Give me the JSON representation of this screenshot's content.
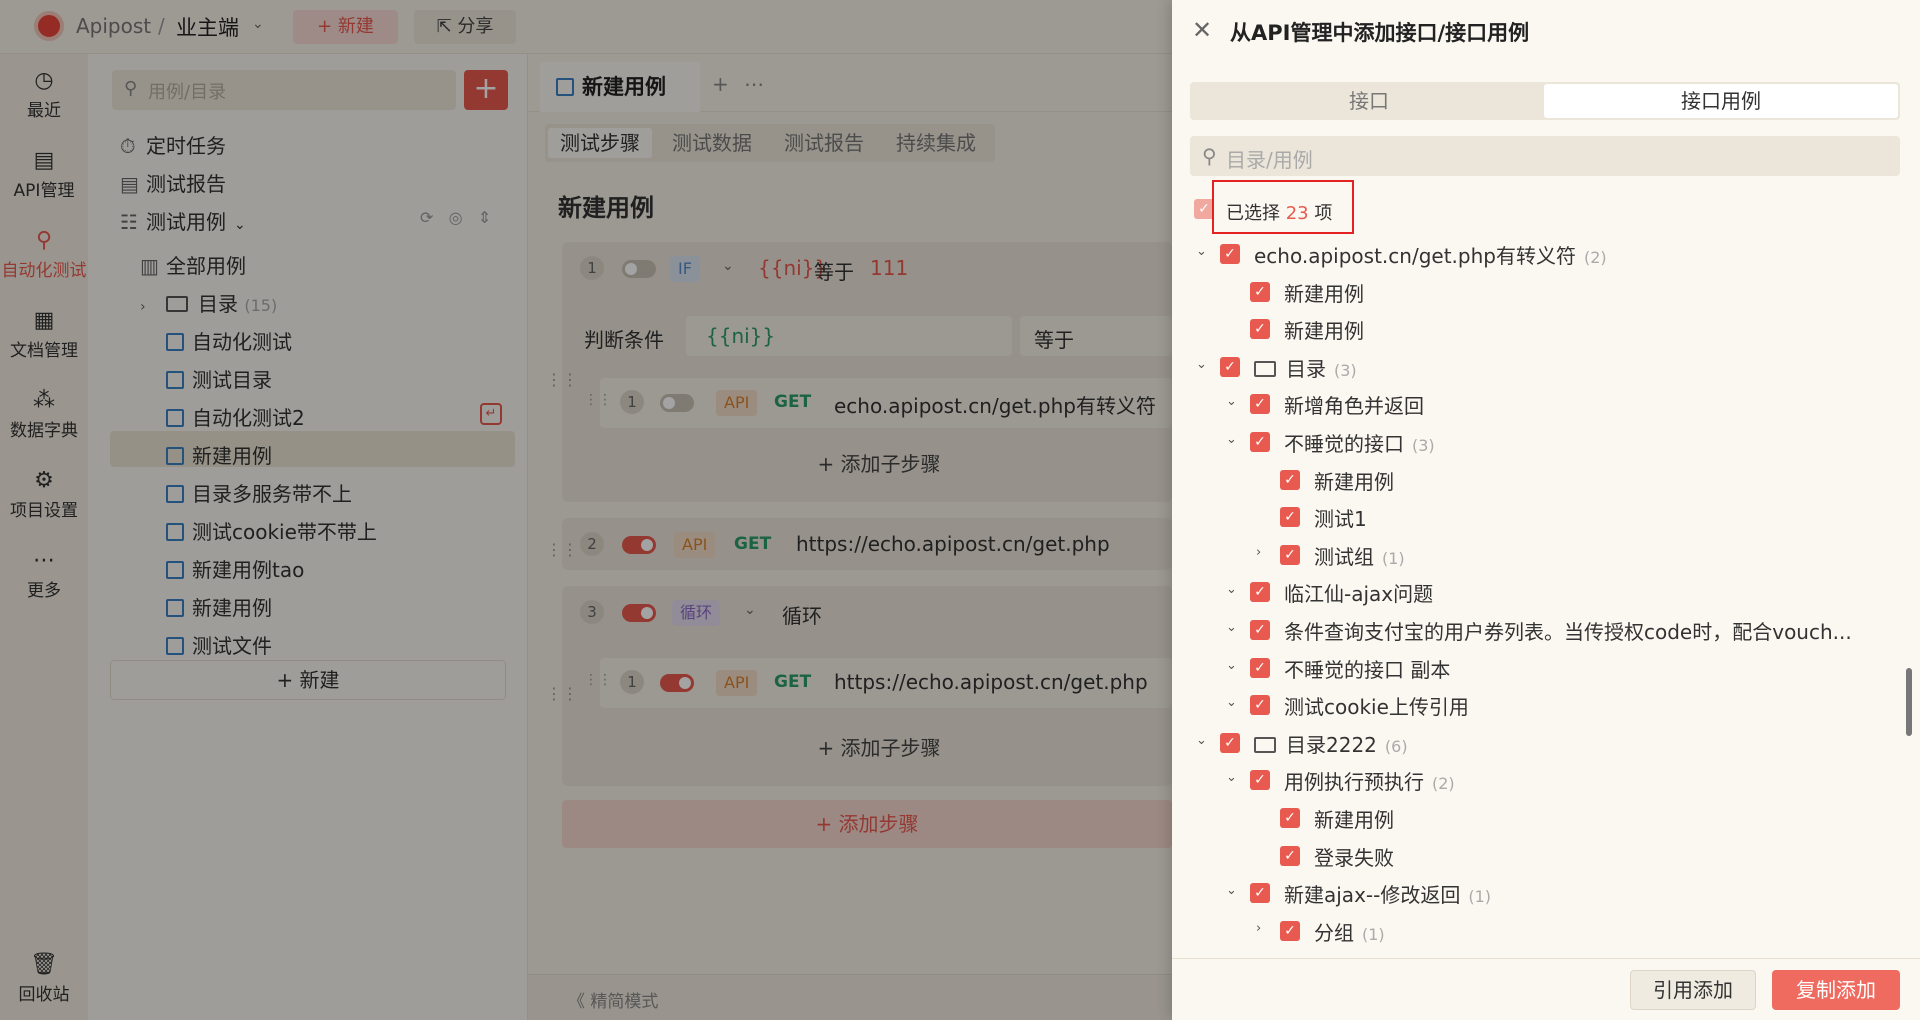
{
  "topbar": {
    "brand": "Apipost",
    "slash": "/",
    "project": "业主端",
    "new_label": "+ 新建",
    "share_label": "分享"
  },
  "leftnav": [
    {
      "label": "最近",
      "icon": "clock-icon"
    },
    {
      "label": "API管理",
      "icon": "api-icon"
    },
    {
      "label": "自动化测试",
      "icon": "automation-icon",
      "active": true
    },
    {
      "label": "文档管理",
      "icon": "document-icon"
    },
    {
      "label": "数据字典",
      "icon": "dictionary-icon"
    },
    {
      "label": "项目设置",
      "icon": "settings-icon"
    },
    {
      "label": "更多",
      "icon": "more-icon"
    },
    {
      "label": "回收站",
      "icon": "trash-icon"
    }
  ],
  "tree": {
    "search_placeholder": "用例/目录",
    "top_items": [
      "定时任务",
      "测试报告",
      "测试用例"
    ],
    "all_cases": "全部用例",
    "folder": {
      "label": "目录",
      "count": "(15)"
    },
    "cases": [
      "自动化测试",
      "测试目录",
      "自动化测试2",
      "新建用例",
      "目录多服务带不上",
      "测试cookie带不带上",
      "新建用例tao",
      "新建用例",
      "测试文件"
    ],
    "new_label": "+ 新建"
  },
  "main": {
    "tab_label": "新建用例",
    "subtabs": [
      "测试步骤",
      "测试数据",
      "测试报告",
      "持续集成"
    ],
    "title": "新建用例",
    "step1": {
      "num": "1",
      "badge": "IF",
      "var": "{{ni}}",
      "op": "等于",
      "value": "111",
      "cond_label": "判断条件",
      "cond_var": "{{ni}}",
      "cond_op": "等于"
    },
    "step1_child": {
      "num": "1",
      "badge": "API",
      "method": "GET",
      "url": "echo.apipost.cn/get.php有转义符"
    },
    "add_child": "+ 添加子步骤",
    "step2": {
      "num": "2",
      "badge": "API",
      "method": "GET",
      "url": "https://echo.apipost.cn/get.php"
    },
    "step3": {
      "num": "3",
      "badge": "循环",
      "label": "循环"
    },
    "step3_child": {
      "num": "1",
      "badge": "API",
      "method": "GET",
      "url": "https://echo.apipost.cn/get.php"
    },
    "add_step": "+ 添加步骤",
    "mode": "《  精简模式"
  },
  "modal": {
    "title": "从API管理中添加接口/接口用例",
    "tabs": [
      "接口",
      "接口用例"
    ],
    "search_placeholder": "目录/用例",
    "selected_prefix": "已选择",
    "selected_count": "23",
    "selected_suffix": "项",
    "rows": [
      {
        "label": "echo.apipost.cn/get.php有转义符",
        "count": "(2)",
        "level": 0,
        "arrow": "down",
        "folder": false
      },
      {
        "label": "新建用例",
        "count": "",
        "level": 1,
        "arrow": "",
        "folder": false
      },
      {
        "label": "新建用例",
        "count": "",
        "level": 1,
        "arrow": "",
        "folder": false
      },
      {
        "label": "目录",
        "count": "(3)",
        "level": 0,
        "arrow": "down",
        "folder": true
      },
      {
        "label": "新增角色并返回",
        "count": "",
        "level": 1,
        "arrow": "down",
        "folder": false
      },
      {
        "label": "不睡觉的接口",
        "count": "(3)",
        "level": 1,
        "arrow": "down",
        "folder": false
      },
      {
        "label": "新建用例",
        "count": "",
        "level": 2,
        "arrow": "",
        "folder": false
      },
      {
        "label": "测试1",
        "count": "",
        "level": 2,
        "arrow": "",
        "folder": false
      },
      {
        "label": "测试组",
        "count": "(1)",
        "level": 2,
        "arrow": "right",
        "folder": false
      },
      {
        "label": "临江仙-ajax问题",
        "count": "",
        "level": 1,
        "arrow": "down",
        "folder": false
      },
      {
        "label": "条件查询支付宝的用户券列表。当传授权code时，配合vouch...",
        "count": "",
        "level": 1,
        "arrow": "down",
        "folder": false
      },
      {
        "label": "不睡觉的接口 副本",
        "count": "",
        "level": 1,
        "arrow": "down",
        "folder": false
      },
      {
        "label": "测试cookie上传引用",
        "count": "",
        "level": 1,
        "arrow": "down",
        "folder": false
      },
      {
        "label": "目录2222",
        "count": "(6)",
        "level": 0,
        "arrow": "down",
        "folder": true
      },
      {
        "label": "用例执行预执行",
        "count": "(2)",
        "level": 1,
        "arrow": "down",
        "folder": false
      },
      {
        "label": "新建用例",
        "count": "",
        "level": 2,
        "arrow": "",
        "folder": false
      },
      {
        "label": "登录失败",
        "count": "",
        "level": 2,
        "arrow": "",
        "folder": false
      },
      {
        "label": "新建ajax--修改返回",
        "count": "(1)",
        "level": 1,
        "arrow": "down",
        "folder": false
      },
      {
        "label": "分组",
        "count": "(1)",
        "level": 2,
        "arrow": "right",
        "folder": false
      }
    ],
    "btn_ref": "引用添加",
    "btn_copy": "复制添加"
  }
}
